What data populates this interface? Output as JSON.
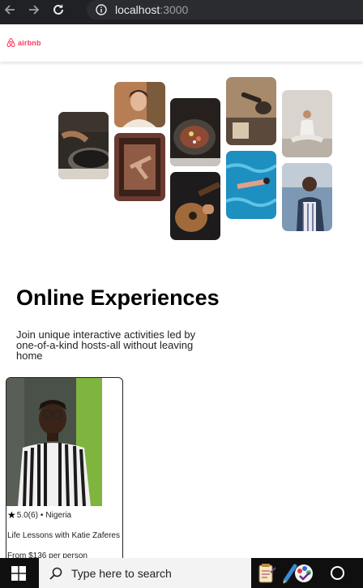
{
  "browser": {
    "url_host": "localhost",
    "url_port": ":3000"
  },
  "navbar": {
    "logo_text": "airbnb",
    "brand_color": "#ff385c"
  },
  "hero": {
    "title": "Online Experiences",
    "subtitle": "Join unique interactive activities led by one-of-a-kind hosts-all without leaving home"
  },
  "card": {
    "rating": "5.0",
    "review_count": "(6)",
    "separator": "•",
    "location": "Nigeria",
    "title": "Life Lessons with Katie Zaferes",
    "price": "From $136 per person"
  },
  "taskbar": {
    "search_placeholder": "Type here to search"
  },
  "icons": [
    "back-arrow-icon",
    "forward-arrow-icon",
    "reload-icon",
    "info-icon",
    "airbnb-logo-icon",
    "star-icon",
    "windows-start-icon",
    "search-icon",
    "notepad-icon",
    "paint-icon",
    "cortana-icon"
  ]
}
